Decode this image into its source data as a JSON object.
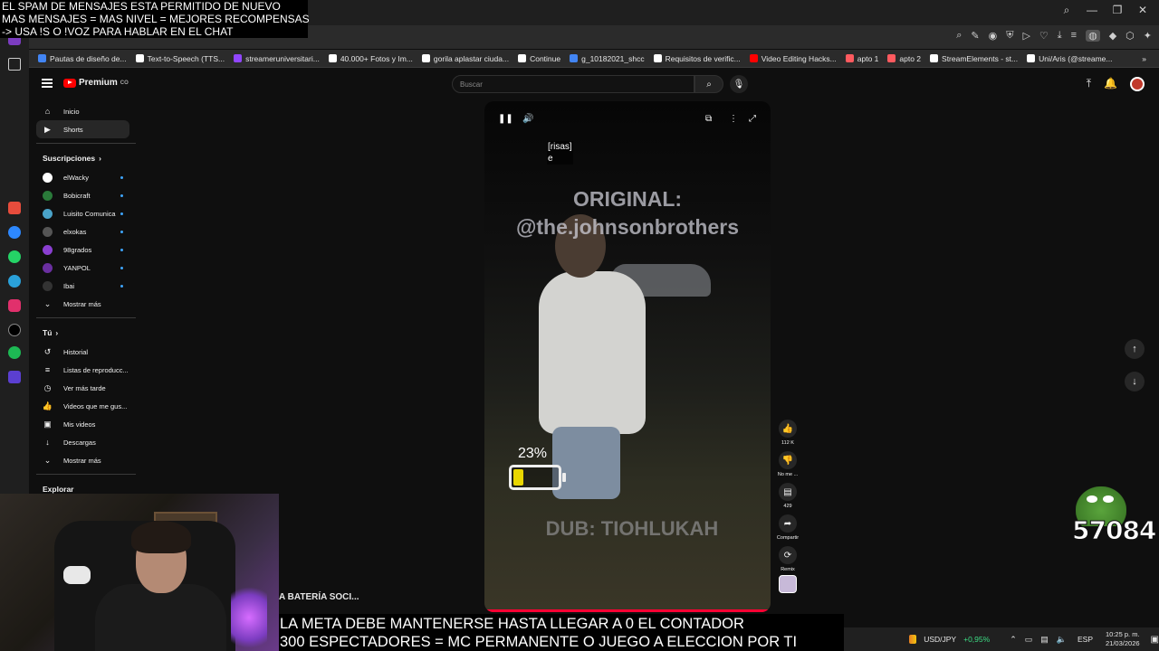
{
  "overlay_top": [
    "EL SPAM DE MENSAJES ESTA PERMITIDO DE NUEVO",
    "MAS MENSAJES = MAS NIVEL = MEJORES RECOMPENSAS",
    "-> USA !S  O !VOZ PARA HABLAR EN EL CHAT"
  ],
  "bookmarks": [
    {
      "label": "Pautas de diseño de...",
      "color": "#4285f4"
    },
    {
      "label": "Text-to-Speech (TTS...",
      "color": "#ffffff"
    },
    {
      "label": "streameruniversitari...",
      "color": "#9146ff"
    },
    {
      "label": "40.000+ Fotos y Im...",
      "color": "#ffffff"
    },
    {
      "label": "gorila aplastar ciuda...",
      "color": "#ffffff"
    },
    {
      "label": "Continue",
      "color": "#ffffff"
    },
    {
      "label": "g_10182021_shcc",
      "color": "#4285f4"
    },
    {
      "label": "Requisitos de verific...",
      "color": "#ffffff"
    },
    {
      "label": "Video Editing Hacks...",
      "color": "#ff0000"
    },
    {
      "label": "apto 1",
      "color": "#ff5a5f"
    },
    {
      "label": "apto 2",
      "color": "#ff5a5f"
    },
    {
      "label": "StreamElements - st...",
      "color": "#ffffff"
    },
    {
      "label": "Uni/Aris (@streame...",
      "color": "#ffffff"
    }
  ],
  "yt": {
    "logo": "Premium",
    "logo_sup": "CO",
    "search_placeholder": "Buscar",
    "nav": [
      {
        "icon": "home-icon",
        "glyph": "⌂",
        "label": "Inicio"
      },
      {
        "icon": "shorts-icon",
        "glyph": "▶",
        "label": "Shorts"
      }
    ],
    "subs_title": "Suscripciones",
    "subs": [
      {
        "label": "elWacky",
        "color": "#ffffff"
      },
      {
        "label": "Bobicraft",
        "color": "#2a7a3a"
      },
      {
        "label": "Luisito Comunica",
        "color": "#4aa3c8"
      },
      {
        "label": "elxokas",
        "color": "#555555"
      },
      {
        "label": "98grados",
        "color": "#8a3fd1"
      },
      {
        "label": "YANPOL",
        "color": "#6a2fa0"
      },
      {
        "label": "Ibai",
        "color": "#333333"
      }
    ],
    "show_more": "Mostrar más",
    "you_title": "Tú",
    "you_items": [
      {
        "icon": "history-icon",
        "glyph": "↺",
        "label": "Historial"
      },
      {
        "icon": "playlist-icon",
        "glyph": "≡",
        "label": "Listas de reproducc..."
      },
      {
        "icon": "watch-later-icon",
        "glyph": "◷",
        "label": "Ver más tarde"
      },
      {
        "icon": "like-icon",
        "glyph": "👍",
        "label": "Videos que me gus..."
      },
      {
        "icon": "my-videos-icon",
        "glyph": "▣",
        "label": "Mis videos"
      },
      {
        "icon": "download-icon",
        "glyph": "↓",
        "label": "Descargas"
      }
    ],
    "show_more_2": "Mostrar más",
    "explore_title": "Explorar"
  },
  "video": {
    "caption_line1": "[risas]",
    "caption_line2": "e",
    "original_line1": "ORIGINAL:",
    "original_line2": "@the.johnsonbrothers",
    "dub": "DUB: TIOHLUKAH",
    "progress": 1.0
  },
  "actions": [
    {
      "icon": "like-icon",
      "glyph": "👍",
      "label": "112 K"
    },
    {
      "icon": "dislike-icon",
      "glyph": "👎",
      "label": "No me ..."
    },
    {
      "icon": "comment-icon",
      "glyph": "▤",
      "label": "429"
    },
    {
      "icon": "share-icon",
      "glyph": "➦",
      "label": "Compartir"
    },
    {
      "icon": "remix-icon",
      "glyph": "⟳",
      "label": "Remix"
    }
  ],
  "battery": {
    "percent_label": "23%",
    "level": 0.23
  },
  "overlay_bottom": [
    "LA META DEBE MANTENERSE HASTA LLEGAR A 0 EL CONTADOR",
    "300 ESPECTADORES = MC PERMANENTE O JUEGO A ELECCION POR TI"
  ],
  "bateria_text": "A BATERÍA SOCI...",
  "counter": "57084",
  "taskbar": {
    "pair": "USD/JPY",
    "change": "+0,95%",
    "lang": "ESP",
    "time": "10:25 p. m.",
    "date": "21/03/2026"
  }
}
